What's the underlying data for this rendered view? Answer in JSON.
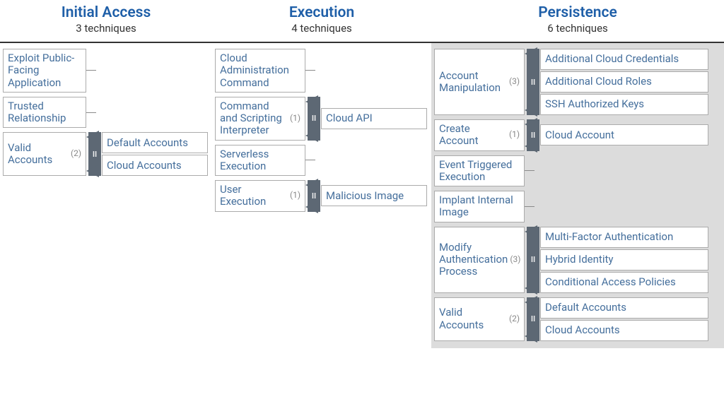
{
  "tactics": [
    {
      "name": "Initial Access",
      "count_label": "3 techniques",
      "techniques": [
        {
          "label": "Exploit Public-Facing Application",
          "sub_count": null,
          "subs": []
        },
        {
          "label": "Trusted Relationship",
          "sub_count": null,
          "subs": []
        },
        {
          "label": "Valid Accounts",
          "sub_count": "(2)",
          "subs": [
            "Default Accounts",
            "Cloud Accounts"
          ]
        }
      ]
    },
    {
      "name": "Execution",
      "count_label": "4 techniques",
      "techniques": [
        {
          "label": "Cloud Administration Command",
          "sub_count": null,
          "subs": []
        },
        {
          "label": "Command and Scripting Interpreter",
          "sub_count": "(1)",
          "subs": [
            "Cloud API"
          ]
        },
        {
          "label": "Serverless Execution",
          "sub_count": null,
          "subs": []
        },
        {
          "label": "User Execution",
          "sub_count": "(1)",
          "subs": [
            "Malicious Image"
          ]
        }
      ]
    },
    {
      "name": "Persistence",
      "count_label": "6 techniques",
      "techniques": [
        {
          "label": "Account Manipulation",
          "sub_count": "(3)",
          "subs": [
            "Additional Cloud Credentials",
            "Additional Cloud Roles",
            "SSH Authorized Keys"
          ]
        },
        {
          "label": "Create Account",
          "sub_count": "(1)",
          "subs": [
            "Cloud Account"
          ]
        },
        {
          "label": "Event Triggered Execution",
          "sub_count": null,
          "subs": []
        },
        {
          "label": "Implant Internal Image",
          "sub_count": null,
          "subs": []
        },
        {
          "label": "Modify Authentication Process",
          "sub_count": "(3)",
          "subs": [
            "Multi-Factor Authentication",
            "Hybrid Identity",
            "Conditional Access Policies"
          ]
        },
        {
          "label": "Valid Accounts",
          "sub_count": "(2)",
          "subs": [
            "Default Accounts",
            "Cloud Accounts"
          ]
        }
      ]
    }
  ],
  "expander_glyph": "II"
}
